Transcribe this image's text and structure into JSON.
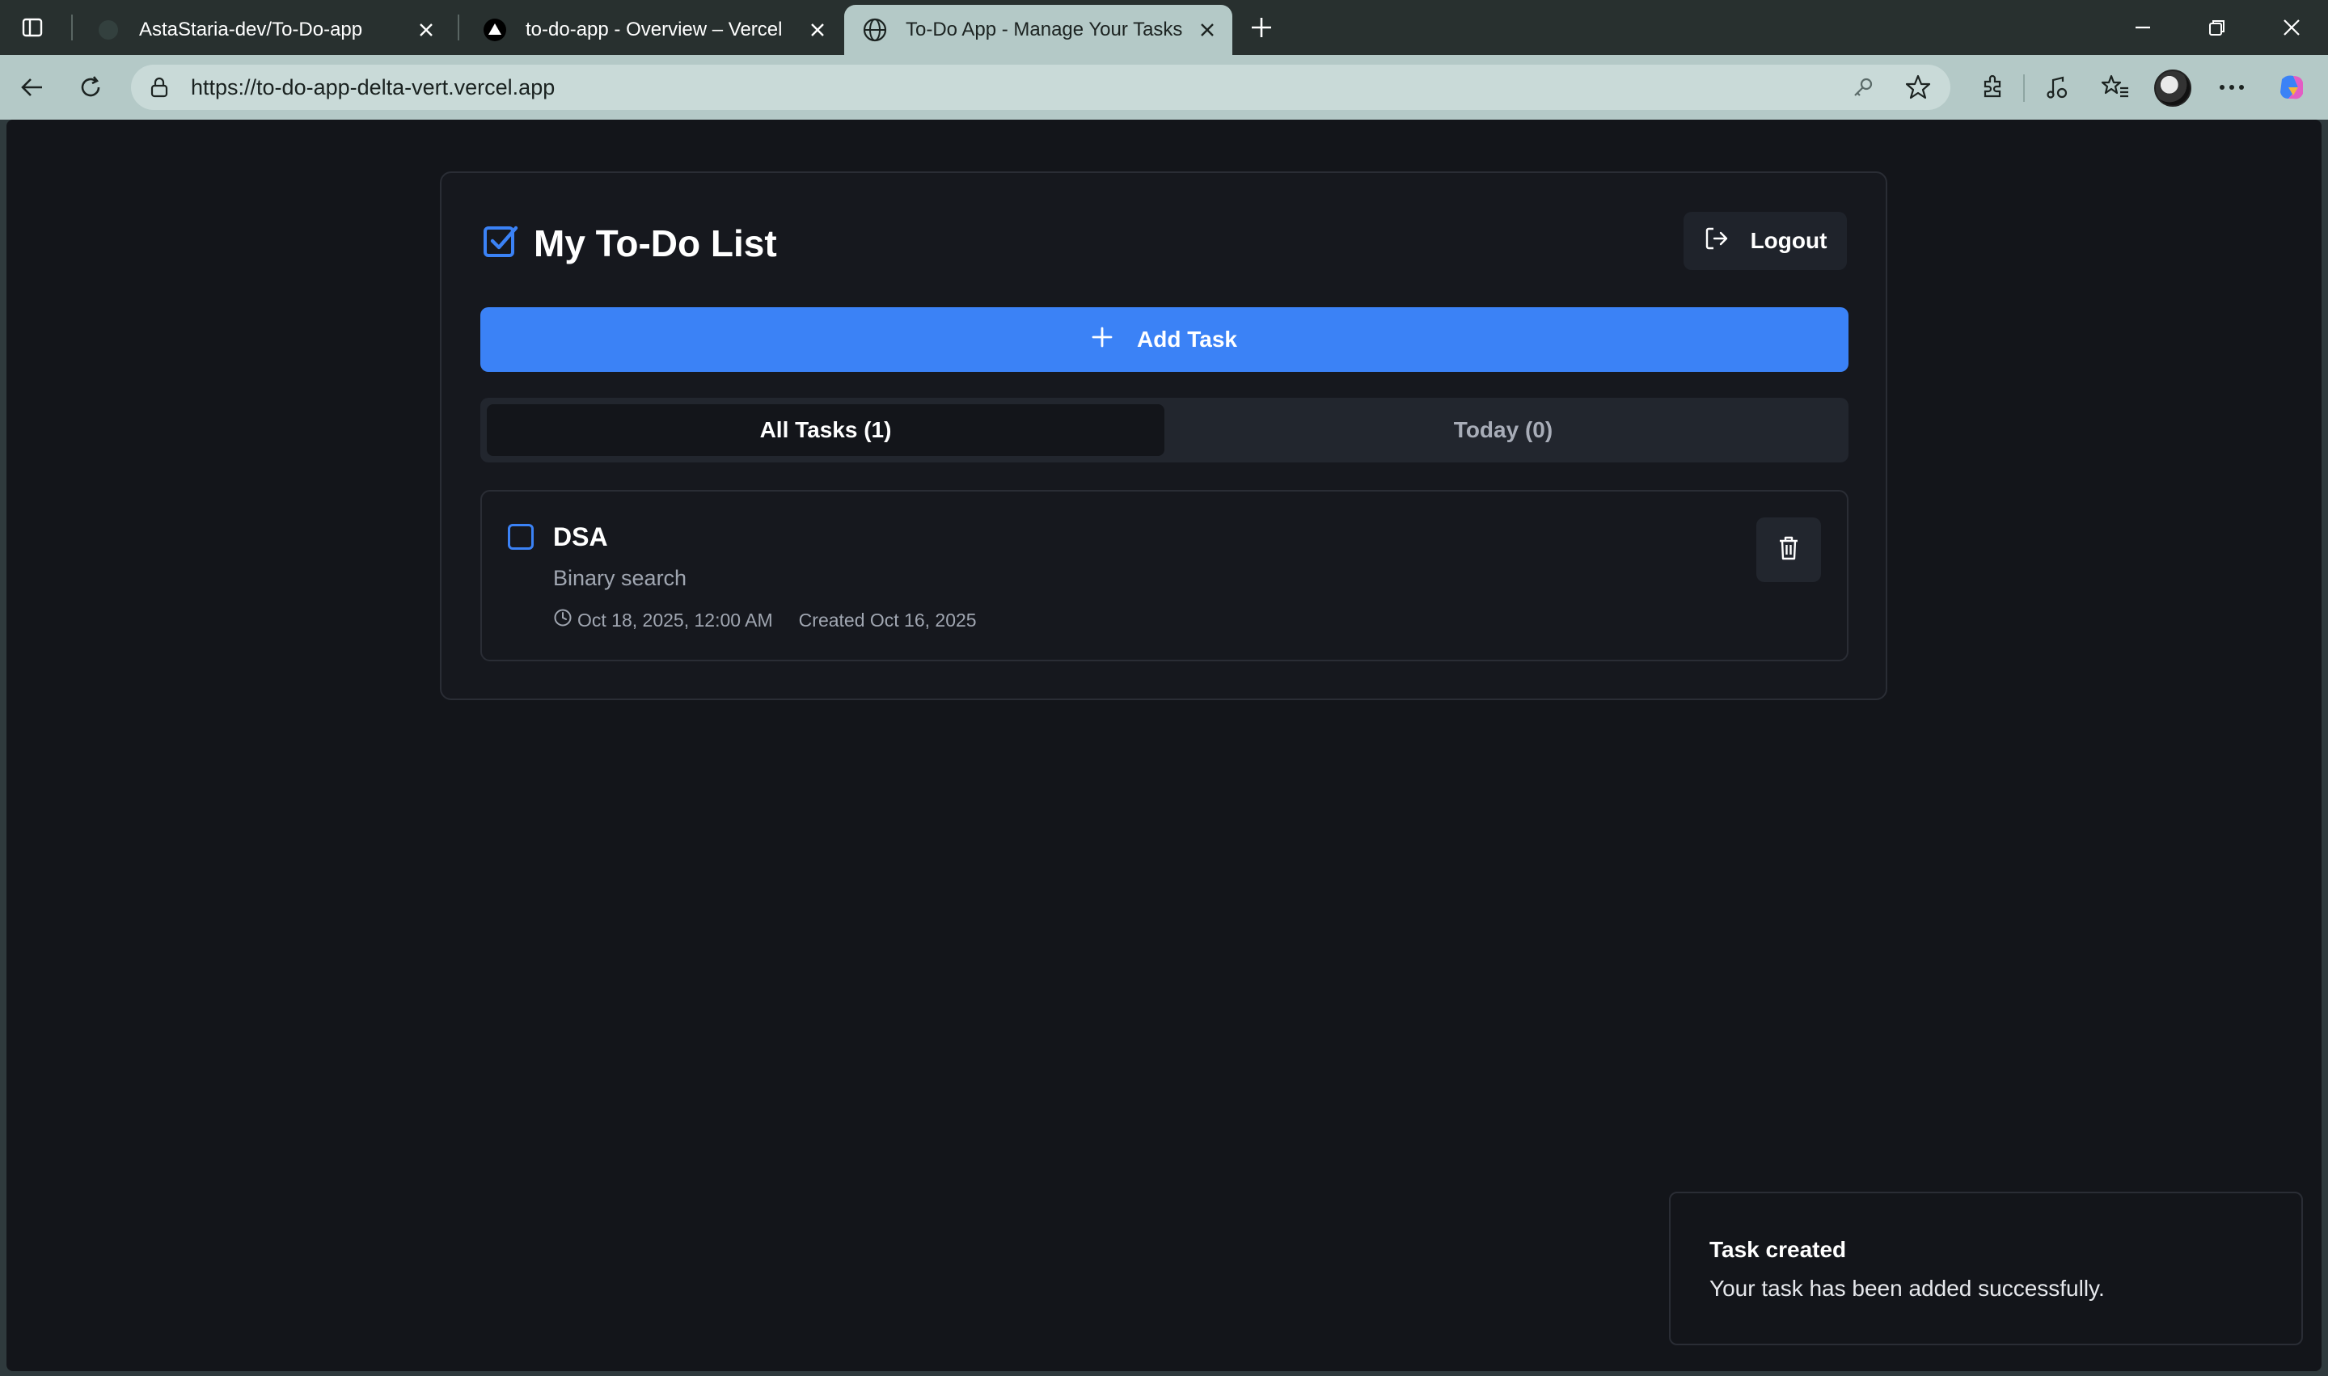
{
  "browser": {
    "tabs": [
      {
        "title": "AstaStaria-dev/To-Do-app",
        "favicon": "github-icon",
        "active": false
      },
      {
        "title": "to-do-app - Overview – Vercel",
        "favicon": "vercel-icon",
        "active": false
      },
      {
        "title": "To-Do App - Manage Your Tasks",
        "favicon": "globe-icon",
        "active": true
      }
    ],
    "url": "https://to-do-app-delta-vert.vercel.app"
  },
  "app": {
    "title": "My To-Do List",
    "logout_label": "Logout",
    "add_task_label": "Add Task",
    "filter_tabs": [
      {
        "label": "All Tasks (1)",
        "active": true
      },
      {
        "label": "Today (0)",
        "active": false
      }
    ],
    "tasks": [
      {
        "title": "DSA",
        "description": "Binary search",
        "due": "Oct 18, 2025, 12:00 AM",
        "created": "Created Oct 16, 2025",
        "completed": false
      }
    ]
  },
  "toast": {
    "title": "Task created",
    "message": "Your task has been added successfully."
  },
  "colors": {
    "accent": "#3b82f6",
    "background": "#13151a",
    "browser_chrome": "#b4c9c7"
  }
}
